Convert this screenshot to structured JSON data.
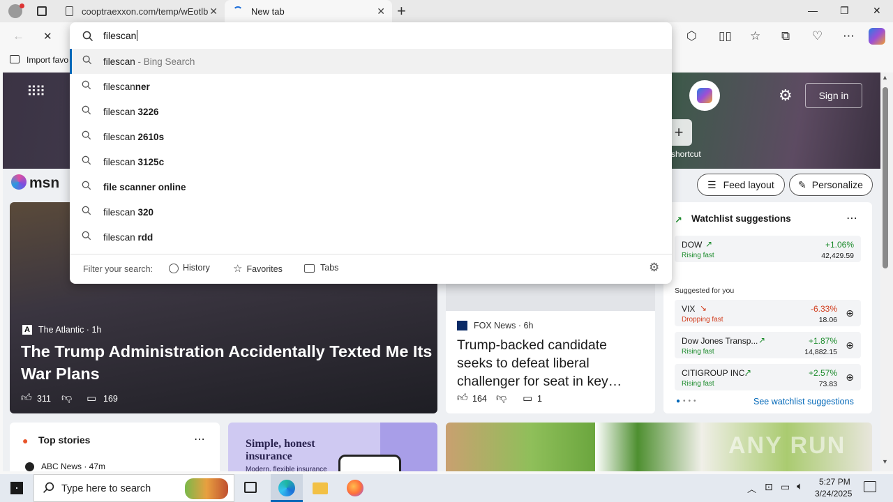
{
  "browser": {
    "tabs": [
      {
        "label": "cooptraexxon.com/temp/wEotlb",
        "close": "✕"
      },
      {
        "label": "New tab",
        "close": "✕"
      }
    ],
    "new_tab": "+",
    "win_minimize": "—",
    "win_restore": "❐",
    "win_close": "✕",
    "favbar_item": "Import favo"
  },
  "omnibox": {
    "input_value": "filescan",
    "suggestions": [
      {
        "pre": "filescan",
        "bold": "",
        "suffix": " - Bing Search"
      },
      {
        "pre": "filescan",
        "bold": "ner",
        "suffix": ""
      },
      {
        "pre": "filescan ",
        "bold": "3226",
        "suffix": ""
      },
      {
        "pre": "filescan ",
        "bold": "2610s",
        "suffix": ""
      },
      {
        "pre": "filescan ",
        "bold": "3125c",
        "suffix": ""
      },
      {
        "pre": "",
        "bold": "file scanner online",
        "suffix": ""
      },
      {
        "pre": "filescan ",
        "bold": "320",
        "suffix": ""
      },
      {
        "pre": "filescan ",
        "bold": "rdd",
        "suffix": ""
      }
    ],
    "filter_label": "Filter your search:",
    "filters": [
      "History",
      "Favorites",
      "Tabs"
    ]
  },
  "msn": {
    "logo": "msn",
    "sign_in": "Sign in",
    "shortcut": "shortcut",
    "feed_layout": "Feed layout",
    "personalize": "Personalize",
    "main_story": {
      "source": "The Atlantic",
      "age": "1h",
      "headline": "The Trump Administration Accidentally Texted Me Its War Plans",
      "likes": "311",
      "comments": "169"
    },
    "fox_story": {
      "source": "FOX News",
      "age": "6h",
      "headline": "Trump-backed candidate seeks to defeat liberal challenger for seat in key…",
      "likes": "164",
      "comments": "1"
    },
    "top_stories": {
      "title": "Top stories",
      "first_source": "ABC News · 47m"
    },
    "ad": {
      "headline": "Simple, honest insurance",
      "sub": "Modern, flexible insurance"
    },
    "watchlist": {
      "title": "Watchlist suggestions",
      "dow": {
        "name": "DOW",
        "status": "Rising fast",
        "change": "+1.06%",
        "value": "42,429.59"
      },
      "suggested_label": "Suggested for you",
      "items": [
        {
          "name": "VIX",
          "status": "Dropping fast",
          "change": "-6.33%",
          "value": "18.06",
          "dir": "down"
        },
        {
          "name": "Dow Jones Transp...",
          "status": "Rising fast",
          "change": "+1.87%",
          "value": "14,882.15",
          "dir": "up"
        },
        {
          "name": "CITIGROUP INC.",
          "status": "Rising fast",
          "change": "+2.57%",
          "value": "73.83",
          "dir": "up"
        }
      ],
      "see_more": "See watchlist suggestions"
    },
    "watermark": "ANY RUN"
  },
  "taskbar": {
    "search_placeholder": "Type here to search",
    "time": "5:27 PM",
    "date": "3/24/2025"
  },
  "colors": {
    "accent": "#0067b8",
    "rising": "#1a8a2a",
    "dropping": "#d13a1a"
  }
}
